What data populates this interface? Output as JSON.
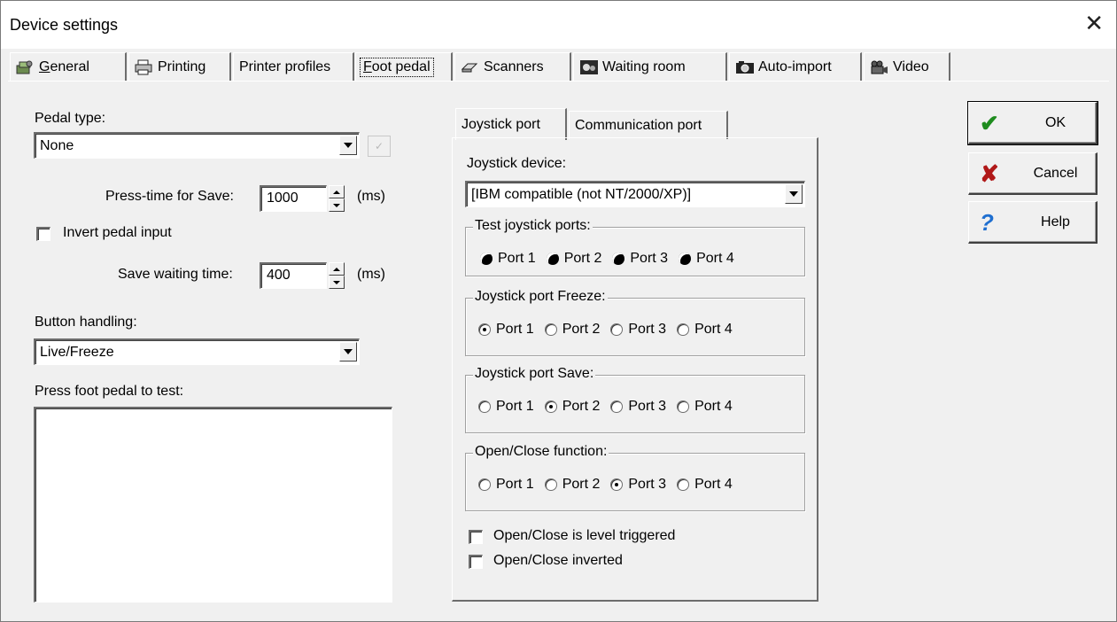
{
  "window": {
    "title": "Device settings",
    "close_glyph": "✕"
  },
  "tabs": [
    {
      "icon": "general-icon",
      "label": "General",
      "mnemonic": "G",
      "rest": "eneral"
    },
    {
      "icon": "printer-icon",
      "label": "Printing"
    },
    {
      "label": "Printer profiles"
    },
    {
      "label": "Foot pedal",
      "mnemonic": "F",
      "rest": "oot pedal",
      "active": true
    },
    {
      "icon": "scanner-icon",
      "label": "Scanners"
    },
    {
      "icon": "waiting-room-icon",
      "label": "Waiting room"
    },
    {
      "icon": "camera-icon",
      "label": "Auto-import"
    },
    {
      "icon": "video-camera-icon",
      "label": "Video"
    }
  ],
  "left": {
    "pedal_type_label": "Pedal type:",
    "pedal_type_value": "None",
    "press_time_label": "Press-time for Save:",
    "press_time_value": "1000",
    "press_time_unit": "(ms)",
    "invert_label": "Invert pedal input",
    "save_wait_label": "Save waiting time:",
    "save_wait_value": "400",
    "save_wait_unit": "(ms)",
    "button_handling_label": "Button handling:",
    "button_handling_value": "Live/Freeze",
    "test_label": "Press foot pedal to test:"
  },
  "inner_tabs": [
    {
      "label": "Joystick port",
      "active": true
    },
    {
      "label": "Communication port"
    }
  ],
  "joystick": {
    "device_label": "Joystick device:",
    "device_value": "[IBM compatible (not NT/2000/XP)]",
    "test_group": {
      "title": "Test joystick ports:",
      "ports": [
        "Port 1",
        "Port 2",
        "Port 3",
        "Port 4"
      ]
    },
    "freeze_group": {
      "title": "Joystick port Freeze:",
      "ports": [
        "Port 1",
        "Port 2",
        "Port 3",
        "Port 4"
      ],
      "selected": 0
    },
    "save_group": {
      "title": "Joystick port Save:",
      "ports": [
        "Port 1",
        "Port 2",
        "Port 3",
        "Port 4"
      ],
      "selected": 1
    },
    "open_close_group": {
      "title": "Open/Close function:",
      "ports": [
        "Port 1",
        "Port 2",
        "Port 3",
        "Port 4"
      ],
      "selected": 2
    },
    "level_triggered_label": "Open/Close is level triggered",
    "inverted_label": "Open/Close inverted"
  },
  "buttons": {
    "ok_label": "OK",
    "cancel_label": "Cancel",
    "help_label": "Help"
  },
  "colors": {
    "ok_check": "#1e8c1e",
    "cancel_x": "#b01818",
    "help_q": "#1f6fd0"
  }
}
